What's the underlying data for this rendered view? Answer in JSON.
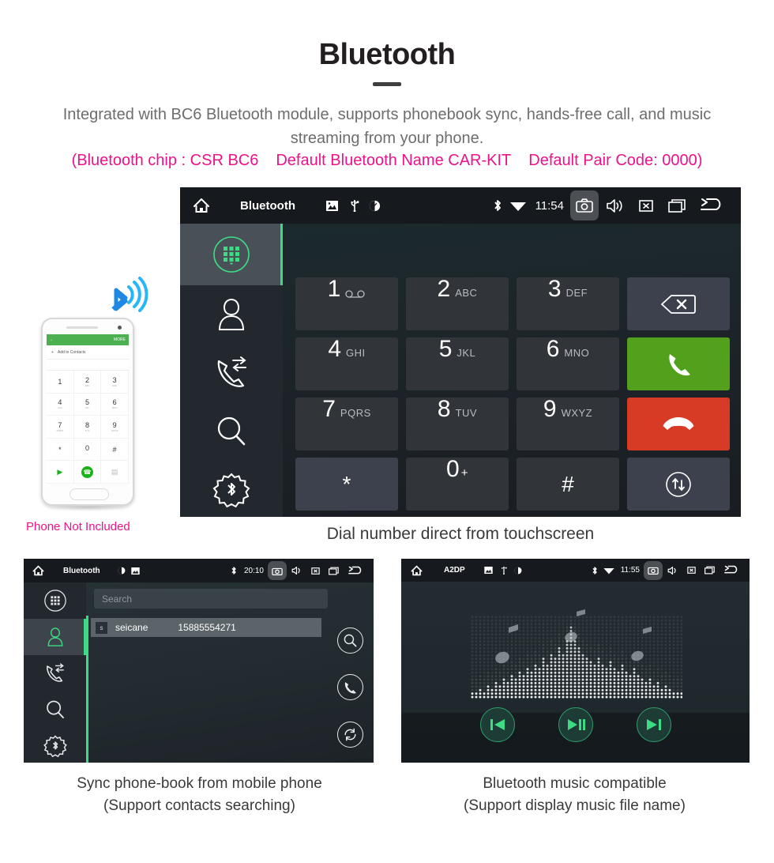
{
  "header": {
    "title": "Bluetooth",
    "subtitle": "Integrated with BC6 Bluetooth module, supports phonebook sync, hands-free call, and music streaming from your phone.",
    "spec_chip": "(Bluetooth chip : CSR BC6",
    "spec_name": "Default Bluetooth Name CAR-KIT",
    "spec_pair": "Default Pair Code: 0000)",
    "pink_color": "#ee1289",
    "title_color": "#231f20",
    "subtitle_color": "#6d6d6d"
  },
  "main_unit": {
    "statusbar": {
      "home_icon": "home-icon",
      "title": "Bluetooth",
      "left_icons": [
        "picture-icon",
        "usb-icon",
        "eye-icon"
      ],
      "bluetooth_icon": "bluetooth-icon",
      "wifi_icon": "wifi-icon",
      "clock": "11:54",
      "camera_icon": "camera-icon",
      "volume_icon": "volume-icon",
      "mute_icon": "mute-icon",
      "recents_icon": "recents-icon",
      "back_icon": "back-icon"
    },
    "sidebar": [
      {
        "name": "dialpad",
        "label": "dialpad-icon",
        "active": true
      },
      {
        "name": "contacts",
        "label": "contact-icon",
        "active": false
      },
      {
        "name": "call-log",
        "label": "call-log-icon",
        "active": false
      },
      {
        "name": "search",
        "label": "search-icon",
        "active": false
      },
      {
        "name": "bt-settings",
        "label": "bluetooth-gear-icon",
        "active": false
      }
    ],
    "keys": [
      {
        "num": "1",
        "sub": "",
        "kind": "num",
        "icon": "voicemail-icon"
      },
      {
        "num": "2",
        "sub": "ABC",
        "kind": "num"
      },
      {
        "num": "3",
        "sub": "DEF",
        "kind": "num"
      },
      {
        "num": "",
        "sub": "",
        "kind": "alt",
        "icon": "backspace-icon"
      },
      {
        "num": "4",
        "sub": "GHI",
        "kind": "num"
      },
      {
        "num": "5",
        "sub": "JKL",
        "kind": "num"
      },
      {
        "num": "6",
        "sub": "MNO",
        "kind": "num"
      },
      {
        "num": "",
        "sub": "",
        "kind": "green",
        "icon": "call-icon"
      },
      {
        "num": "7",
        "sub": "PQRS",
        "kind": "num"
      },
      {
        "num": "8",
        "sub": "TUV",
        "kind": "num"
      },
      {
        "num": "9",
        "sub": "WXYZ",
        "kind": "num"
      },
      {
        "num": "",
        "sub": "",
        "kind": "red",
        "icon": "hangup-icon"
      },
      {
        "num": "*",
        "sub": "",
        "kind": "alt-sym"
      },
      {
        "num": "0",
        "sub": "+",
        "kind": "num-sym"
      },
      {
        "num": "#",
        "sub": "",
        "kind": "sym"
      },
      {
        "num": "",
        "sub": "",
        "kind": "alt",
        "icon": "transfer-icon"
      }
    ],
    "caption": "Dial number direct from touchscreen",
    "accent_color": "#3ddc84",
    "call_color": "#53a01c",
    "hangup_color": "#d73b25"
  },
  "phone_mock": {
    "bluetooth_icon": "bluetooth-wave-icon",
    "app_bar_more": "MORE",
    "add_to_contacts": "Add to Contacts",
    "keys": [
      {
        "n": "1",
        "s": ""
      },
      {
        "n": "2",
        "s": "ABC"
      },
      {
        "n": "3",
        "s": "DEF"
      },
      {
        "n": "4",
        "s": "GHI"
      },
      {
        "n": "5",
        "s": "JKL"
      },
      {
        "n": "6",
        "s": "MNO"
      },
      {
        "n": "7",
        "s": "PQRS"
      },
      {
        "n": "8",
        "s": "TUV"
      },
      {
        "n": "9",
        "s": "WXYZ"
      },
      {
        "n": "*",
        "s": ""
      },
      {
        "n": "0",
        "s": "+"
      },
      {
        "n": "#",
        "s": ""
      }
    ],
    "note": "Phone Not Included"
  },
  "phonebook_unit": {
    "statusbar": {
      "home_icon": "home-icon",
      "title": "Bluetooth",
      "clock": "20:10"
    },
    "search_placeholder": "Search",
    "contact": {
      "initial": "s",
      "name": "seicane",
      "number": "15885554271"
    },
    "actions": [
      "search-icon",
      "call-icon",
      "sync-icon"
    ],
    "caption_line1": "Sync phone-book from mobile phone",
    "caption_line2": "(Support contacts searching)"
  },
  "music_unit": {
    "statusbar": {
      "home_icon": "home-icon",
      "title": "A2DP",
      "clock": "11:55"
    },
    "controls": [
      "previous-icon",
      "play-pause-icon",
      "next-icon"
    ],
    "caption_line1": "Bluetooth music compatible",
    "caption_line2": "(Support display music file name)"
  }
}
